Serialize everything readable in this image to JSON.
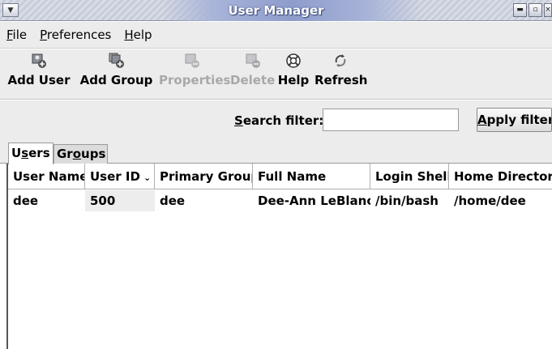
{
  "window": {
    "title": "User Manager",
    "system_menu_icon": "chevron-down-icon",
    "controls": [
      "minimize-icon",
      "maximize-icon",
      "close-icon"
    ],
    "minimize_glyph": "▬",
    "maximize_glyph": "▫",
    "close_glyph": "×"
  },
  "menubar": {
    "file": {
      "underline": "F",
      "rest": "ile"
    },
    "preferences": {
      "underline": "P",
      "rest": "references"
    },
    "help": {
      "underline": "H",
      "rest": "elp"
    }
  },
  "toolbar": {
    "add_user": "Add User",
    "add_group": "Add Group",
    "properties": "Properties",
    "delete": "Delete",
    "help": "Help",
    "refresh": "Refresh"
  },
  "search": {
    "label_underline": "S",
    "label_rest": "earch filter:",
    "value": "",
    "apply_underline": "A",
    "apply_rest": "pply filter"
  },
  "tabs": {
    "users": {
      "pre": "U",
      "underline": "s",
      "post": "ers"
    },
    "groups": {
      "pre": "Gr",
      "underline": "o",
      "post": "ups"
    }
  },
  "table": {
    "columns": [
      "User Name",
      "User ID",
      "Primary Group",
      "Full Name",
      "Login Shell",
      "Home Directory"
    ],
    "sort_icon": "⌄",
    "rows": [
      [
        "dee",
        "500",
        "dee",
        "Dee-Ann LeBlanc",
        "/bin/bash",
        "/home/dee"
      ]
    ]
  },
  "colors": {
    "title_text": "#ffffff",
    "disabled_text": "#a8a8a8",
    "background": "#ececec"
  }
}
